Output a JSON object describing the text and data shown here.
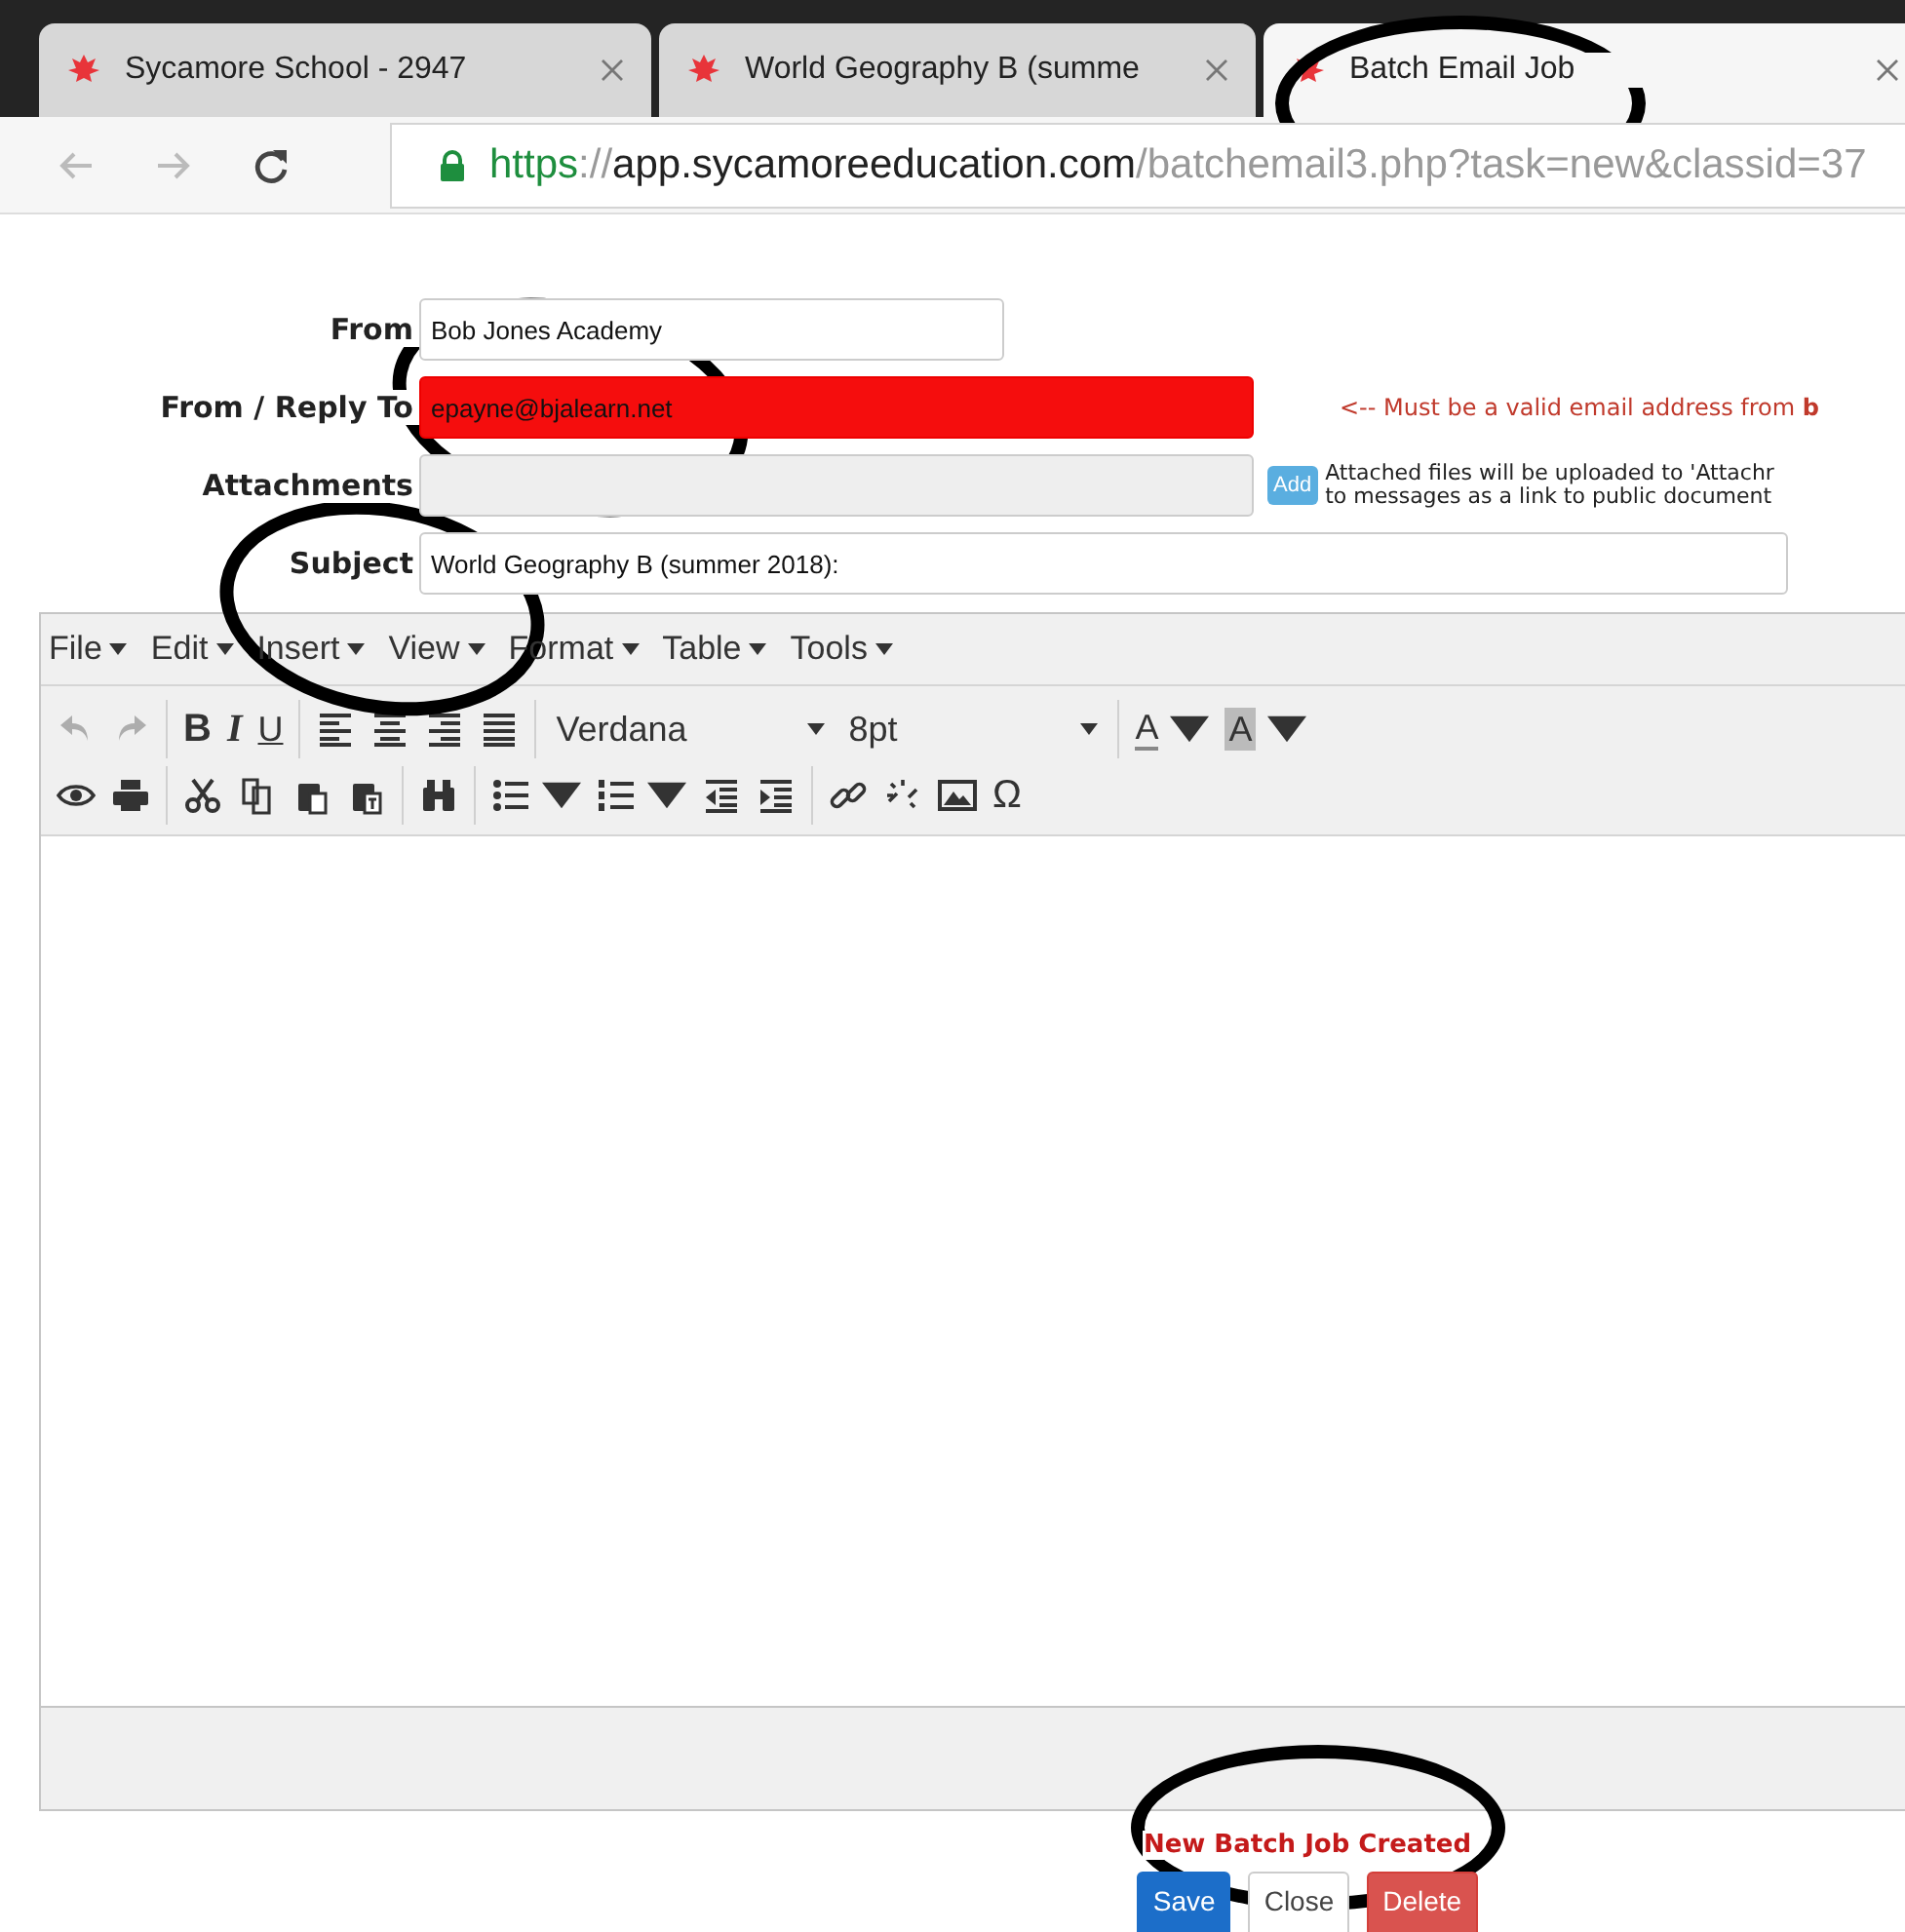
{
  "browser": {
    "tabs": [
      {
        "title": "Sycamore School - 2947",
        "selected": false,
        "circled": false
      },
      {
        "title": "World Geography B (summe",
        "selected": false,
        "circled": false
      },
      {
        "title": "Batch Email Job",
        "selected": true,
        "circled": true
      }
    ],
    "address": {
      "scheme": "https",
      "separator": "://",
      "host": "app.sycamoreeducation.com",
      "path": "/batchemail3.php?task=new&classid=37"
    }
  },
  "form": {
    "fields": [
      {
        "kind": "text",
        "label": "From",
        "value": "Bob Jones Academy",
        "circled": false,
        "label_circled": false
      },
      {
        "kind": "invalid",
        "label": "From / Reply To",
        "value": "epayne@bjalearn.net",
        "hint": "<-- Must be a valid email address from **b**",
        "circled": true,
        "label_circled": false
      },
      {
        "kind": "attachment",
        "label": "Attachments",
        "button": "Add",
        "note": [
          "Attached files will be uploaded to 'Attachr",
          "to messages as a link to public document"
        ],
        "circled": false,
        "label_circled": false
      },
      {
        "kind": "wide",
        "label": "Subject",
        "value": "World Geography B (summer 2018):",
        "circled": false,
        "label_circled": true
      }
    ]
  },
  "editor": {
    "menus": [
      "File",
      "Edit",
      "Insert",
      "View",
      "Format",
      "Table",
      "Tools"
    ],
    "toolbar": [
      [
        {
          "kind": "undo",
          "disabled": true
        },
        {
          "kind": "redo",
          "disabled": true
        },
        {
          "kind": "separator"
        },
        {
          "kind": "bold",
          "label": "B"
        },
        {
          "kind": "italic",
          "label": "I"
        },
        {
          "kind": "underline",
          "label": "U"
        },
        {
          "kind": "separator"
        },
        {
          "kind": "align-left"
        },
        {
          "kind": "align-center"
        },
        {
          "kind": "align-right"
        },
        {
          "kind": "align-justify"
        },
        {
          "kind": "separator"
        },
        {
          "kind": "select",
          "value": "Verdana"
        },
        {
          "kind": "select",
          "value": "8pt"
        },
        {
          "kind": "separator"
        },
        {
          "kind": "text-color",
          "label": "A"
        },
        {
          "kind": "back-color",
          "label": "A"
        }
      ],
      [
        {
          "kind": "preview"
        },
        {
          "kind": "print"
        },
        {
          "kind": "separator"
        },
        {
          "kind": "cut"
        },
        {
          "kind": "copy"
        },
        {
          "kind": "paste"
        },
        {
          "kind": "paste-text"
        },
        {
          "kind": "separator"
        },
        {
          "kind": "find"
        },
        {
          "kind": "separator"
        },
        {
          "kind": "bullet-list"
        },
        {
          "kind": "numbered-list"
        },
        {
          "kind": "outdent"
        },
        {
          "kind": "indent"
        },
        {
          "kind": "separator"
        },
        {
          "kind": "link"
        },
        {
          "kind": "unlink"
        },
        {
          "kind": "image"
        },
        {
          "kind": "symbol",
          "label": "Ω"
        }
      ]
    ]
  },
  "footer": {
    "message": "New Batch Job Created",
    "circled": true,
    "buttons": [
      {
        "label": "Save",
        "kind": "primary"
      },
      {
        "label": "Close",
        "kind": "default"
      },
      {
        "label": "Delete",
        "kind": "danger"
      }
    ]
  }
}
